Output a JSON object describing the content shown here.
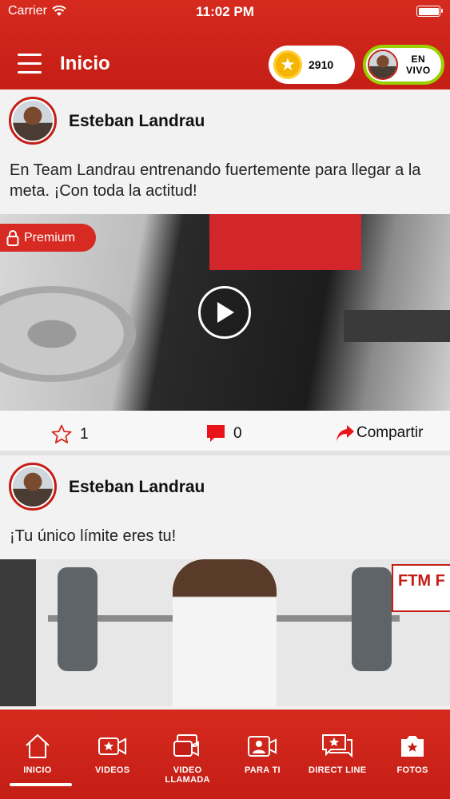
{
  "status_bar": {
    "carrier": "Carrier",
    "time": "11:02 PM"
  },
  "header": {
    "title": "Inicio",
    "coins": "2910",
    "live_label_1": "EN",
    "live_label_2": "VIVO"
  },
  "posts": [
    {
      "author": "Esteban Landrau",
      "text": "En Team Landrau entrenando fuertemente para llegar a la meta. ¡Con toda la actitud!",
      "badge": "Premium",
      "likes": "1",
      "comments": "0",
      "share_label": "Compartir"
    },
    {
      "author": "Esteban Landrau",
      "text": "¡Tu único límite eres tu!",
      "sign_text": "FTM F"
    }
  ],
  "bottom_nav": [
    {
      "label": "INICIO",
      "icon": "home-icon"
    },
    {
      "label": "VIDEOS",
      "icon": "video-star-icon"
    },
    {
      "label": "VIDEO LLAMADA",
      "icon": "video-call-icon"
    },
    {
      "label": "PARA TI",
      "icon": "person-video-icon"
    },
    {
      "label": "DIRECT LINE",
      "icon": "chat-star-icon"
    },
    {
      "label": "FOTOS",
      "icon": "photo-star-icon"
    }
  ],
  "colors": {
    "brand_red": "#c41e16",
    "live_border": "#9bd000",
    "coin_gold": "#f5b400"
  }
}
